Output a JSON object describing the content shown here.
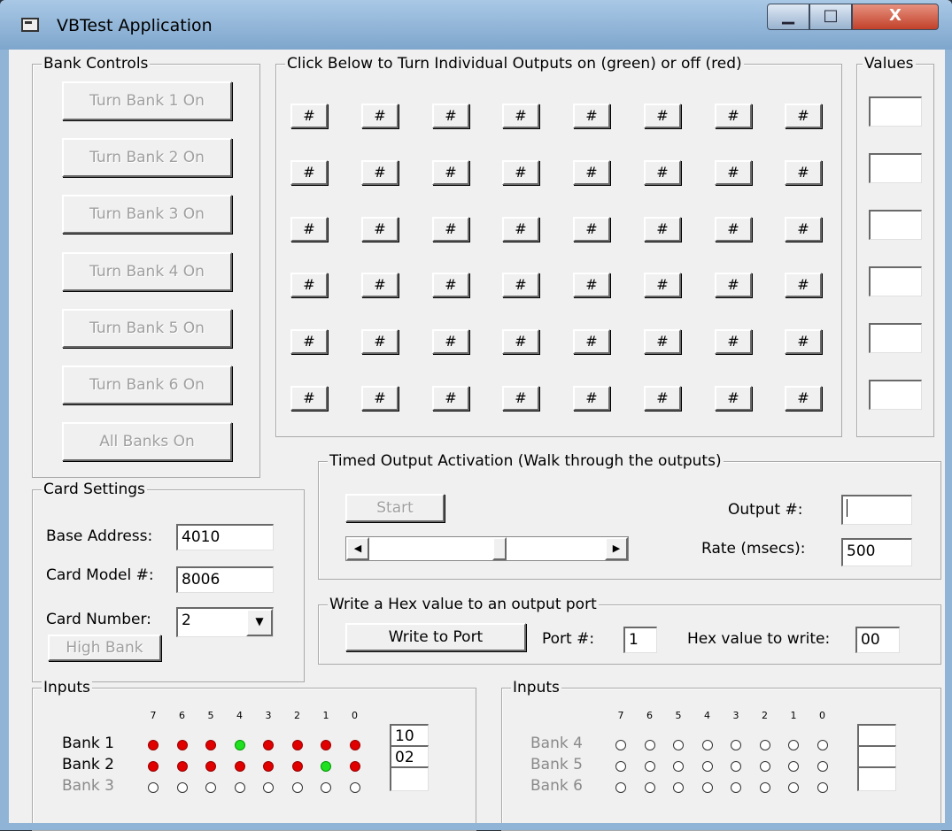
{
  "window": {
    "title": "VBTest Application",
    "min_glyph": "▁",
    "max_glyph": "□",
    "close_glyph": "X"
  },
  "bank_controls": {
    "label": "Bank Controls",
    "buttons": [
      "Turn Bank 1 On",
      "Turn Bank 2 On",
      "Turn Bank 3 On",
      "Turn Bank 4 On",
      "Turn Bank 5 On",
      "Turn Bank 6 On",
      "All Banks On"
    ]
  },
  "outputs": {
    "label": "Click Below to Turn Individual Outputs on (green) or off (red)",
    "button_glyph": "#"
  },
  "values": {
    "label": "Values",
    "fields": [
      "",
      "",
      "",
      "",
      "",
      ""
    ]
  },
  "card_settings": {
    "label": "Card Settings",
    "base_address_label": "Base Address:",
    "base_address": "4010",
    "card_model_label": "Card Model #:",
    "card_model": "8006",
    "card_number_label": "Card Number:",
    "card_number": "2",
    "high_bank": "High Bank"
  },
  "timed": {
    "label": "Timed Output Activation  (Walk through the outputs)",
    "start": "Start",
    "output_label": "Output #:",
    "output_value": "",
    "rate_label": "Rate (msecs):",
    "rate_value": "500",
    "slider_position": 0.55
  },
  "hex": {
    "label": "Write a Hex value to an output port",
    "write_button": "Write to Port",
    "port_label": "Port #:",
    "port_value": "1",
    "hex_label": "Hex value to write:",
    "hex_value": "00"
  },
  "inputs_left": {
    "label": "Inputs",
    "bits": [
      "7",
      "6",
      "5",
      "4",
      "3",
      "2",
      "1",
      "0"
    ],
    "banks": [
      {
        "name": "Bank 1",
        "enabled": true,
        "states": [
          "red",
          "red",
          "red",
          "green",
          "red",
          "red",
          "red",
          "red"
        ],
        "value": "10"
      },
      {
        "name": "Bank 2",
        "enabled": true,
        "states": [
          "red",
          "red",
          "red",
          "red",
          "red",
          "red",
          "green",
          "red"
        ],
        "value": "02"
      },
      {
        "name": "Bank 3",
        "enabled": false,
        "states": [
          "empty",
          "empty",
          "empty",
          "empty",
          "empty",
          "empty",
          "empty",
          "empty"
        ],
        "value": ""
      }
    ]
  },
  "inputs_right": {
    "label": "Inputs",
    "bits": [
      "7",
      "6",
      "5",
      "4",
      "3",
      "2",
      "1",
      "0"
    ],
    "banks": [
      {
        "name": "Bank 4",
        "enabled": false,
        "states": [
          "empty",
          "empty",
          "empty",
          "empty",
          "empty",
          "empty",
          "empty",
          "empty"
        ],
        "value": ""
      },
      {
        "name": "Bank 5",
        "enabled": false,
        "states": [
          "empty",
          "empty",
          "empty",
          "empty",
          "empty",
          "empty",
          "empty",
          "empty"
        ],
        "value": ""
      },
      {
        "name": "Bank 6",
        "enabled": false,
        "states": [
          "empty",
          "empty",
          "empty",
          "empty",
          "empty",
          "empty",
          "empty",
          "empty"
        ],
        "value": ""
      }
    ]
  }
}
